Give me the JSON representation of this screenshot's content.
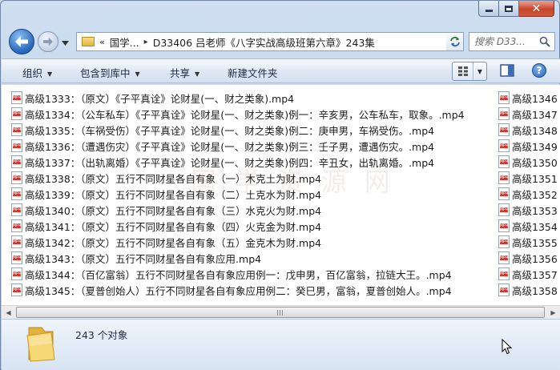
{
  "window": {
    "controls": {
      "minimize": "minimize",
      "maximize": "maximize",
      "close": "✕"
    }
  },
  "nav": {
    "path_overflow": "«",
    "breadcrumb": [
      "国学...",
      "D33406 吕老师《八字实战高级班第六章》243集"
    ],
    "search_placeholder": "搜索 D33..."
  },
  "toolbar": {
    "items": [
      "组织",
      "包含到库中",
      "共享",
      "新建文件夹"
    ]
  },
  "files": [
    "高级1333：（原文）《子平真诠》论财星(一、财之类象).mp4",
    "高级1334：（公车私车）《子平真诠》论财星(一、财之类象)例一：辛亥男，公车私车，取象。.mp4",
    "高级1335：（车祸受伤）《子平真诠》论财星(一、财之类象)例二：庚申男，车祸受伤。.mp4",
    "高级1336：（遭遇伤灾）《子平真诠》论财星(一、财之类象)例三：壬子男，遭遇伤灾。.mp4",
    "高级1337：（出轨离婚）《子平真诠》论财星(一、财之类象)例四：辛丑女，出轨离婚。.mp4",
    "高级1338：（原文）五行不同财星各自有象（一）木克土为财.mp4",
    "高级1339：（原文）五行不同财星各自有象（二）土克水为财.mp4",
    "高级1340：（原文）五行不同财星各自有象（三）水克火为财.mp4",
    "高级1341：（原文）五行不同财星各自有象（四）火克金为财.mp4",
    "高级1342：（原文）五行不同财星各自有象（五）金克木为财.mp4",
    "高级1343：（原文）五行不同财星各自有象应用.mp4",
    "高级1344：（百亿富翁）五行不同财星各自有象应用例一：戊申男，百亿富翁，拉链大王。.mp4",
    "高级1345：（夏普创始人）五行不同财星各自有象应用例二：癸巳男，富翁，夏普创始人。.mp4"
  ],
  "files_col2": [
    "高级1346",
    "高级1347",
    "高级1348",
    "高级1349",
    "高级1350",
    "高级1351",
    "高级1352",
    "高级1353",
    "高级1354",
    "高级1355",
    "高级1356",
    "高级1357",
    "高级1358"
  ],
  "watermark": "国 学 资 源 网",
  "status": {
    "count_text": "243 个对象"
  },
  "colors": {
    "accent": "#2d6cc0",
    "close": "#c9452b",
    "toolbar": "#dfe9f5"
  }
}
